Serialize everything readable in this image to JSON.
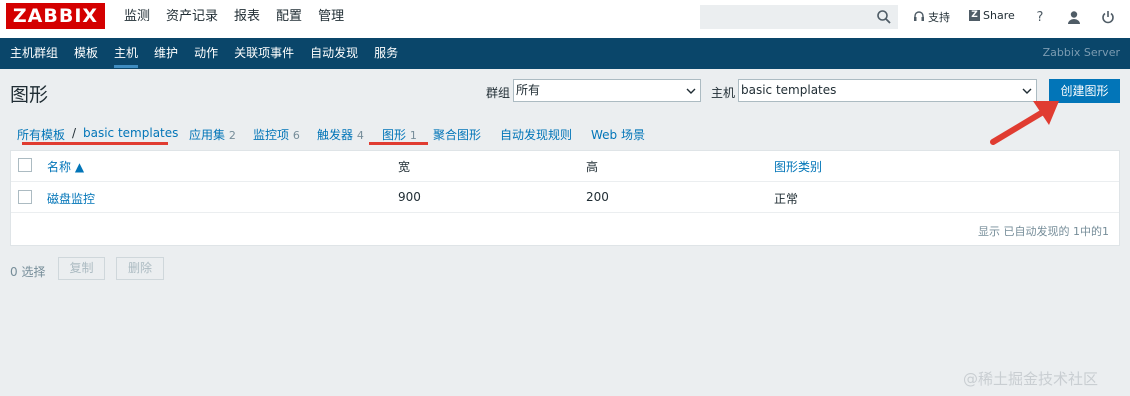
{
  "logo": "ZABBIX",
  "top_menu": [
    "监测",
    "资产记录",
    "报表",
    "配置",
    "管理"
  ],
  "top_right": {
    "support": "支持",
    "share": "Share",
    "help": "?"
  },
  "sub_menu": [
    "主机群组",
    "模板",
    "主机",
    "维护",
    "动作",
    "关联项事件",
    "自动发现",
    "服务"
  ],
  "server_name": "Zabbix Server",
  "page_title": "图形",
  "filters": {
    "group_label": "群组",
    "group_value": "所有",
    "host_label": "主机",
    "host_value": "basic templates"
  },
  "create_button": "创建图形",
  "breadcrumb": {
    "all_templates": "所有模板",
    "separator": "/",
    "template": "basic templates",
    "tabs": [
      {
        "label": "应用集",
        "count": "2"
      },
      {
        "label": "监控项",
        "count": "6"
      },
      {
        "label": "触发器",
        "count": "4"
      },
      {
        "label": "图形",
        "count": "1"
      },
      {
        "label": "聚合图形",
        "count": ""
      },
      {
        "label": "自动发现规则",
        "count": ""
      },
      {
        "label": "Web 场景",
        "count": ""
      }
    ]
  },
  "table": {
    "headers": {
      "name": "名称 ▲",
      "width": "宽",
      "height": "高",
      "type": "图形类别"
    },
    "rows": [
      {
        "name": "磁盘监控",
        "width": "900",
        "height": "200",
        "type": "正常"
      }
    ],
    "footer": "显示 已自动发现的 1中的1"
  },
  "actions": {
    "selected": "0 选择",
    "copy": "复制",
    "delete": "删除"
  },
  "watermark": "@稀土掘金技术社区",
  "colors": {
    "brand": "#d40000",
    "nav": "#0a466a",
    "accent": "#0275b8",
    "annotation": "#e03c31"
  }
}
